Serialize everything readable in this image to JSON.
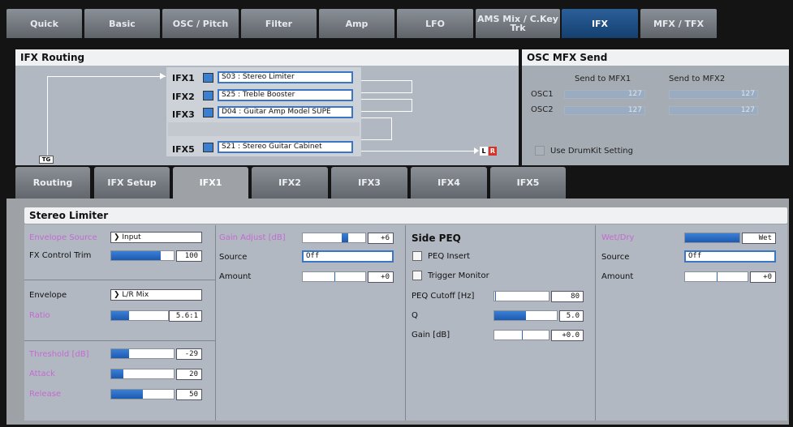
{
  "top_tabs": [
    {
      "label": "Quick"
    },
    {
      "label": "Basic"
    },
    {
      "label": "OSC / Pitch"
    },
    {
      "label": "Filter"
    },
    {
      "label": "Amp"
    },
    {
      "label": "LFO"
    },
    {
      "label": "AMS Mix / C.Key Trk"
    },
    {
      "label": "IFX"
    },
    {
      "label": "MFX / TFX"
    }
  ],
  "routing": {
    "title": "IFX Routing",
    "tg_label": "TG",
    "out_l": "L",
    "out_r": "R",
    "slots": [
      {
        "label": "IFX1",
        "effect": "S03 : Stereo Limiter",
        "on": true
      },
      {
        "label": "IFX2",
        "effect": "S25 : Treble Booster",
        "on": true
      },
      {
        "label": "IFX3",
        "effect": "D04 : Guitar Amp Model SUPE",
        "on": true
      },
      {
        "label": "IFX5",
        "effect": "S21 : Stereo Guitar Cabinet",
        "on": true
      }
    ]
  },
  "osc_mfx": {
    "title": "OSC MFX Send",
    "col1": "Send to MFX1",
    "col2": "Send to MFX2",
    "rows": [
      {
        "label": "OSC1",
        "v1": "127",
        "v2": "127"
      },
      {
        "label": "OSC2",
        "v1": "127",
        "v2": "127"
      }
    ],
    "drumkit_label": "Use DrumKit Setting"
  },
  "sub_tabs": [
    {
      "label": "Routing"
    },
    {
      "label": "IFX Setup"
    },
    {
      "label": "IFX1"
    },
    {
      "label": "IFX2"
    },
    {
      "label": "IFX3"
    },
    {
      "label": "IFX4"
    },
    {
      "label": "IFX5"
    }
  ],
  "editor": {
    "title": "Stereo Limiter",
    "col1": {
      "env_source_label": "Envelope Source",
      "env_source_value": "Input",
      "fx_trim_label": "FX Control Trim",
      "fx_trim_value": "100",
      "fx_trim_level": 0.79,
      "envelope_label": "Envelope",
      "envelope_value": "L/R Mix",
      "ratio_label": "Ratio",
      "ratio_value": "5.6:1",
      "ratio_level": 0.32,
      "threshold_label": "Threshold [dB]",
      "threshold_value": "-29",
      "threshold_level": 0.28,
      "attack_label": "Attack",
      "attack_value": "20",
      "attack_level": 0.2,
      "release_label": "Release",
      "release_value": "50",
      "release_level": 0.5
    },
    "col2": {
      "gain_adj_label": "Gain Adjust [dB]",
      "gain_adj_value": "+6",
      "source_label": "Source",
      "source_value": "Off",
      "amount_label": "Amount",
      "amount_value": "+0"
    },
    "col3": {
      "title": "Side PEQ",
      "peq_insert_label": "PEQ Insert",
      "trigger_monitor_label": "Trigger Monitor",
      "cutoff_label": "PEQ Cutoff [Hz]",
      "cutoff_value": "80",
      "q_label": "Q",
      "q_value": "5.0",
      "q_level": 0.5,
      "gain_label": "Gain [dB]",
      "gain_value": "+0.0"
    },
    "col4": {
      "wetdry_label": "Wet/Dry",
      "wetdry_value": "Wet",
      "wetdry_level": 1.0,
      "source_label": "Source",
      "source_value": "Off",
      "amount_label": "Amount",
      "amount_value": "+0"
    }
  }
}
